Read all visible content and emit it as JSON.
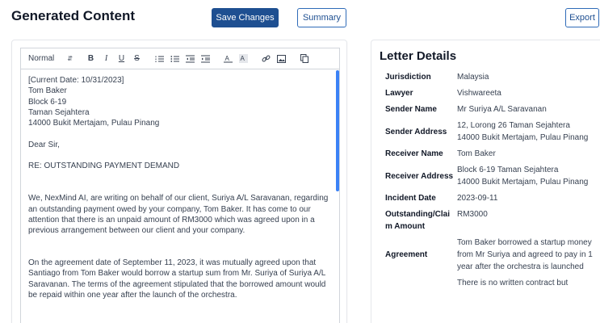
{
  "header": {
    "title": "Generated Content",
    "save_label": "Save Changes",
    "summary_label": "Summary",
    "export_label": "Export"
  },
  "toolbar": {
    "format_select": "Normal",
    "icons": [
      "bold-icon",
      "italic-icon",
      "underline-icon",
      "strikethrough-icon",
      "ordered-list-icon",
      "bullet-list-icon",
      "outdent-icon",
      "indent-icon",
      "text-color-icon",
      "background-color-icon",
      "link-icon",
      "image-icon",
      "copy-icon"
    ],
    "bold": "B",
    "italic": "I",
    "underline": "U",
    "strike": "S"
  },
  "editor": {
    "lines": [
      "[Current Date: 10/31/2023]",
      "",
      "Tom Baker\nBlock 6-19\nTaman Sejahtera\n14000 Bukit Mertajam, Pulau Pinang",
      "",
      "Dear Sir,",
      "",
      "RE: OUTSTANDING PAYMENT DEMAND",
      "",
      "",
      "We, NexMind AI, are writing on behalf of our client, Suriya A/L Saravanan, regarding an outstanding payment owed by your company, Tom Baker. It has come to our attention that there is an unpaid amount of RM3000 which was agreed upon in a previous arrangement between our client and your company.",
      "",
      "",
      "On the agreement date of September 11, 2023, it was mutually agreed upon that Santiago from Tom Baker would borrow a startup sum from Mr. Suriya of Suriya A/L Saravanan. The terms of the agreement stipulated that the borrowed amount would be repaid within one year after the launch of the orchestra."
    ]
  },
  "details": {
    "title": "Letter Details",
    "rows": [
      {
        "k": "Jurisdiction",
        "v": "Malaysia"
      },
      {
        "k": "Lawyer",
        "v": "Vishwareeta"
      },
      {
        "k": "Sender Name",
        "v": "Mr Suriya A/L Saravanan"
      },
      {
        "k": "Sender Address",
        "v": "12, Lorong 26 Taman Sejahtera\n14000 Bukit Mertajam, Pulau Pinang"
      },
      {
        "k": "Receiver Name",
        "v": "Tom Baker"
      },
      {
        "k": "Receiver Address",
        "v": "Block 6-19 Taman Sejahtera\n14000 Bukit Mertajam, Pulau Pinang"
      },
      {
        "k": "Incident Date",
        "v": "2023-09-11"
      },
      {
        "k": "Outstanding/Claim Amount",
        "v": "RM3000"
      },
      {
        "k": "Agreement",
        "v": "Tom Baker borrowed a startup money from Mr Suriya and agreed to pay in 1 year after the orchestra is launched"
      },
      {
        "k": "",
        "v": "There is no written contract but"
      }
    ]
  },
  "colors": {
    "primary": "#1e4f91",
    "scrollbar": "#3b82f6"
  }
}
